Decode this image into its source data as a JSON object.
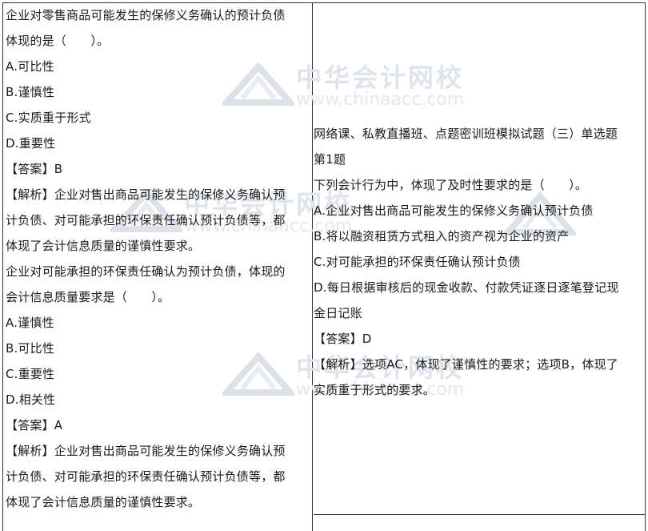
{
  "watermark": {
    "cn": "中华会计网校",
    "en": "www.chinaacc.com"
  },
  "left_lines": [
    "企业对零售商品可能发生的保修义务确认的预计负债",
    "体现的是（　　）。",
    "A.可比性",
    "B.谨慎性",
    "C.实质重于形式",
    "D.重要性",
    "【答案】B",
    "【解析】企业对售出商品可能发生的保修义务确认预",
    "计负债、对可能承担的环保责任确认预计负债等，都",
    "体现了会计信息质量的谨慎性要求。",
    "企业对可能承担的环保责任确认为预计负债，体现的",
    "会计信息质量要求是（　　）。",
    "A.谨慎性",
    "B.可比性",
    "C.重要性",
    "D.相关性",
    "【答案】A",
    "【解析】企业对售出商品可能发生的保修义务确认预",
    "计负债、对可能承担的环保责任确认预计负债等，都",
    "体现了会计信息质量的谨慎性要求。"
  ],
  "right_lines": [
    "网络课、私教直播班、点题密训班模拟试题（三）单选题",
    "第1题",
    "下列会计行为中，体现了及时性要求的是（　　）。",
    "A.企业对售出商品可能发生的保修义务确认预计负债",
    "B.将以融资租赁方式租入的资产视为企业的资产",
    "C.对可能承担的环保责任确认预计负债",
    "D.每日根据审核后的现金收款、付款凭证逐日逐笔登记现",
    "金日记账",
    "【答案】D",
    "【解析】选项AC，体现了谨慎性的要求；选项B，体现了",
    "实质重于形式的要求。"
  ]
}
